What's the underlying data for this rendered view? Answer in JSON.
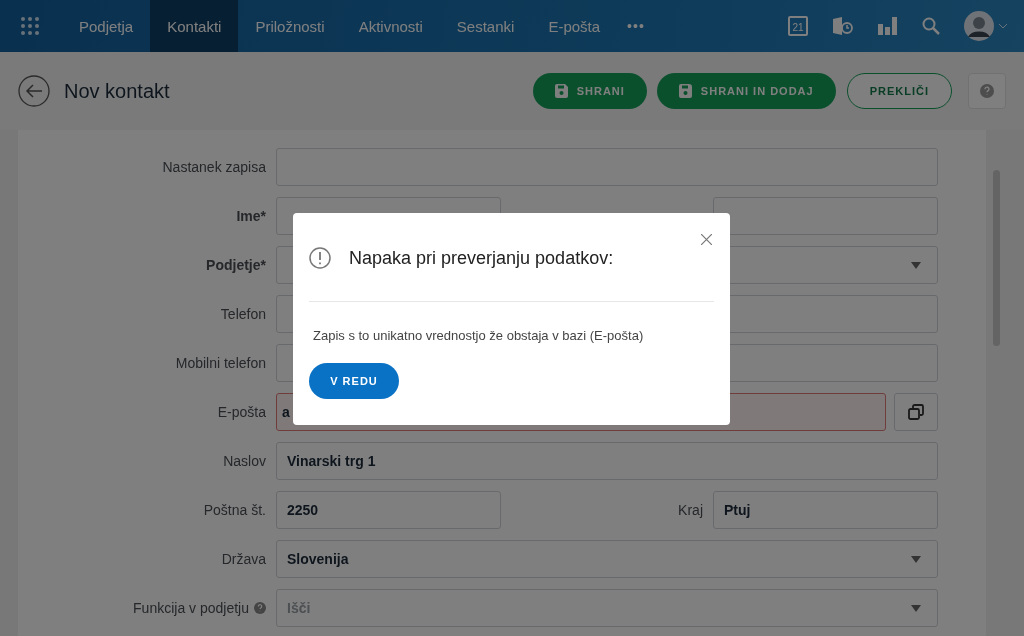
{
  "nav": {
    "items": [
      {
        "label": "Podjetja",
        "selected": false
      },
      {
        "label": "Kontakti",
        "selected": true
      },
      {
        "label": "Priložnosti",
        "selected": false
      },
      {
        "label": "Aktivnosti",
        "selected": false
      },
      {
        "label": "Sestanki",
        "selected": false
      },
      {
        "label": "E-pošta",
        "selected": false
      }
    ],
    "more": "•••",
    "calendar_day": "21"
  },
  "header": {
    "title": "Nov kontakt",
    "buttons": [
      {
        "label": "SHRANI",
        "kind": "primary"
      },
      {
        "label": "SHRANI IN DODAJ",
        "kind": "primary-plus"
      },
      {
        "label": "PREKLIČI",
        "kind": "outline"
      }
    ]
  },
  "form": {
    "rows": [
      {
        "kind": "text",
        "label": "Nastanek zapisa"
      },
      {
        "kind": "split",
        "label": "Ime*",
        "required": true,
        "right_label": ""
      },
      {
        "kind": "select",
        "label": "Podjetje*",
        "required": true
      },
      {
        "kind": "text",
        "label": "Telefon"
      },
      {
        "kind": "text",
        "label": "Mobilni telefon"
      },
      {
        "kind": "email",
        "label": "E-pošta",
        "value": "a",
        "error": true
      },
      {
        "kind": "text",
        "label": "Naslov",
        "value": "Vinarski trg 1"
      },
      {
        "kind": "split",
        "label": "Poštna št.",
        "value": "2250",
        "right_label": "Kraj",
        "right_value": "Ptuj"
      },
      {
        "kind": "select",
        "label": "Država",
        "value": "Slovenija"
      },
      {
        "kind": "select",
        "label": "Funkcija v podjetju",
        "help": true,
        "placeholder": "Išči"
      }
    ]
  },
  "dialog": {
    "title": "Napaka pri preverjanju podatkov:",
    "message": "Zapis s to unikatno vrednostjo že obstaja v bazi (E-pošta)",
    "button": "V REDU"
  }
}
